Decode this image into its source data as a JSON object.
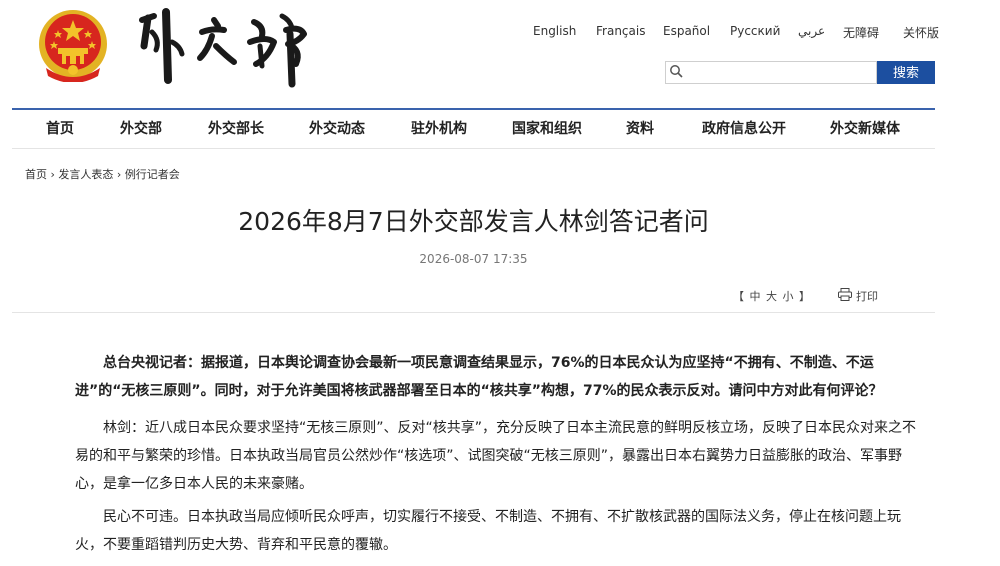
{
  "header": {
    "site_logo_label": "外交部",
    "languages": [
      "English",
      "Français",
      "Español",
      "Русский",
      "عربي",
      "无障碍",
      "关怀版"
    ],
    "search": {
      "placeholder": "",
      "button_label": "搜索"
    }
  },
  "nav": {
    "items": [
      "首页",
      "外交部",
      "外交部长",
      "外交动态",
      "驻外机构",
      "国家和组织",
      "资料",
      "政府信息公开",
      "外交新媒体"
    ]
  },
  "breadcrumb": {
    "items": [
      "首页",
      "发言人表态",
      "例行记者会"
    ],
    "separator": " › "
  },
  "article": {
    "title": "2026年8月7日外交部发言人林剑答记者问",
    "date": "2026-08-07 17:35",
    "font_size_label": "【 中  大  小 】",
    "print_label": "打印",
    "question": "总台央视记者：据报道，日本舆论调查协会最新一项民意调查结果显示，76%的日本民众认为应坚持“不拥有、不制造、不运进”的“无核三原则”。同时，对于允许美国将核武器部署至日本的“核共享”构想，77%的民众表示反对。请问中方对此有何评论？",
    "answer_1": "林剑：近八成日本民众要求坚持“无核三原则”、反对“核共享”，充分反映了日本主流民意的鲜明反核立场，反映了日本民众对来之不易的和平与繁荣的珍惜。日本执政当局官员公然炒作“核选项”、试图突破“无核三原则”，暴露出日本右翼势力日益膨胀的政治、军事野心，是拿一亿多日本人民的未来豪赌。",
    "answer_2": "民心不可违。日本执政当局应倾听民众呼声，切实履行不接受、不制造、不拥有、不扩散核武器的国际法义务，停止在核问题上玩火，不要重蹈错判历史大势、背弃和平民意的覆辙。"
  },
  "colors": {
    "accent_blue": "#1c4fa0",
    "nav_line": "#3a63ad",
    "emblem_red": "#d7261e",
    "emblem_gold": "#f3c32a"
  }
}
